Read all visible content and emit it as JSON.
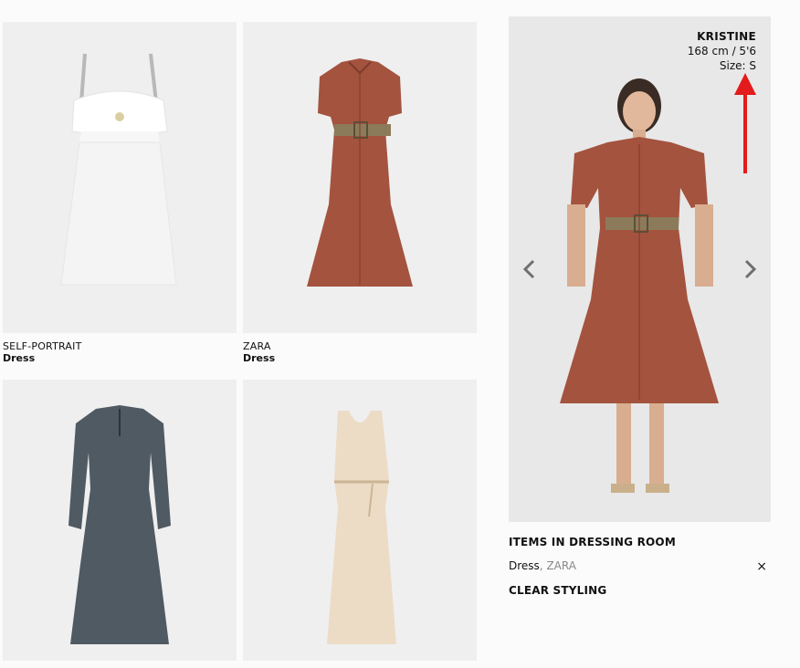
{
  "products": [
    {
      "brand": "SELF-PORTRAIT",
      "type": "Dress"
    },
    {
      "brand": "ZARA",
      "type": "Dress"
    },
    {
      "brand": "",
      "type": ""
    },
    {
      "brand": "",
      "type": ""
    }
  ],
  "model": {
    "name": "KRISTINE",
    "height": "168 cm / 5'6",
    "size": "Size: S"
  },
  "dressing_room": {
    "title": "ITEMS IN DRESSING ROOM",
    "item_type": "Dress",
    "item_separator": ", ",
    "item_brand": "ZARA",
    "remove_symbol": "×",
    "clear_label": "CLEAR STYLING"
  },
  "icons": {
    "prev": "chevron-left-icon",
    "next": "chevron-right-icon",
    "remove": "close-icon",
    "annotation": "red-arrow-annotation"
  },
  "colors": {
    "leather": "#a4533e",
    "belt": "#8b7b5a",
    "arrow": "#e31b1b"
  }
}
